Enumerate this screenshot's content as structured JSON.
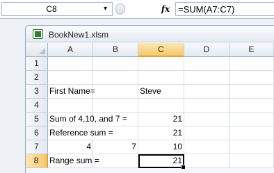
{
  "formula_bar": {
    "name_box": "C8",
    "fx_label": "fx",
    "formula": "=SUM(A7:C7)"
  },
  "workbook": {
    "title": "BookNew1.xlsm"
  },
  "grid": {
    "columns": [
      "A",
      "B",
      "C",
      "D",
      "E"
    ],
    "selected_column": "C",
    "selected_row": "8",
    "rows": [
      {
        "num": "1",
        "A": "",
        "B": "",
        "C": "",
        "D": "",
        "E": ""
      },
      {
        "num": "2",
        "A": "",
        "B": "",
        "C": "",
        "D": "",
        "E": ""
      },
      {
        "num": "3",
        "A": "First Name=",
        "B": "",
        "C": "Steve",
        "D": "",
        "E": ""
      },
      {
        "num": "4",
        "A": "",
        "B": "",
        "C": "",
        "D": "",
        "E": ""
      },
      {
        "num": "5",
        "A": "Sum of 4,10, and 7 =",
        "B": "",
        "C": "21",
        "D": "",
        "E": ""
      },
      {
        "num": "6",
        "A": "Reference sum =",
        "B": "",
        "C": "21",
        "D": "",
        "E": ""
      },
      {
        "num": "7",
        "A": "4",
        "B": "7",
        "C": "10",
        "D": "",
        "E": ""
      },
      {
        "num": "8",
        "A": "Range sum =",
        "B": "",
        "C": "21",
        "D": "",
        "E": ""
      }
    ]
  }
}
